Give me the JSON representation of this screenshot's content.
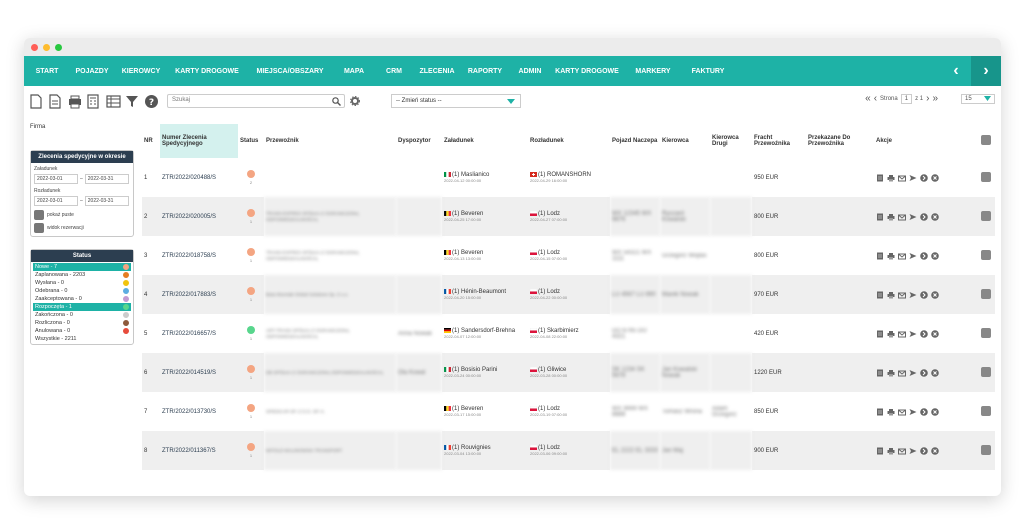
{
  "nav": {
    "items": [
      "START",
      "POJAZDY",
      "KIEROWCY",
      "KARTY DROGOWE",
      "MIEJSCA/OBSZARY",
      "MAPA",
      "CRM",
      "ZLECENIA",
      "RAPORTY",
      "ADMIN",
      "KARTY DROGOWE",
      "MARKERY",
      "FAKTURY"
    ],
    "prev": "‹",
    "next": "›"
  },
  "toolbar": {
    "search_placeholder": "Szukaj",
    "status_select": "-- Zmień status --",
    "pager": {
      "label": "Strona",
      "page": "1",
      "of": "z 1",
      "per_page": "15"
    }
  },
  "sidebar": {
    "firma_label": "Firma",
    "filter_title": "Zlecenia spedycyjne w okresie",
    "zaladunek_label": "Załadunek",
    "rozladunek_label": "Rozładunek",
    "date_from": "2022-03-01",
    "date_to": "2022-03-31",
    "dash": "–",
    "check_empty": "pokaż puste",
    "check_reserved": "widok rezerwacji",
    "status_title": "Status",
    "statuses": [
      {
        "label": "Nowe - 7",
        "color": "#f4a582",
        "active": true
      },
      {
        "label": "Zaplanowana - 2203",
        "color": "#e67e22",
        "active": false
      },
      {
        "label": "Wysłana - 0",
        "color": "#f1c40f",
        "active": false
      },
      {
        "label": "Odebrana - 0",
        "color": "#5dade2",
        "active": false
      },
      {
        "label": "Zaakceptowana - 0",
        "color": "#c39bd3",
        "active": false
      },
      {
        "label": "Rozpoczęta - 1",
        "color": "#58d68d",
        "active": true
      },
      {
        "label": "Zakończona - 0",
        "color": "#cccccc",
        "active": false
      },
      {
        "label": "Rozliczona - 0",
        "color": "#8e5a3c",
        "active": false
      },
      {
        "label": "Anulowana - 0",
        "color": "#e74c3c",
        "active": false
      },
      {
        "label": "Wszystkie - 2211",
        "color": "",
        "active": false
      }
    ]
  },
  "table": {
    "headers": {
      "nr": "NR",
      "numer": "Numer Zlecenia Spedycyjnego",
      "status": "Status",
      "przewoznik": "Przewoźnik",
      "dyspozytor": "Dyspozytor",
      "zaladunek": "Załadunek",
      "rozladunek": "Rozładunek",
      "pojazd": "Pojazd Naczepa",
      "kierowca": "Kierowca",
      "kierowca2": "Kierowca Drugi",
      "fracht": "Fracht Przewoźnika",
      "przekazane": "Przekazane Do Przewoźnika",
      "akcje": "Akcje"
    },
    "rows": [
      {
        "nr": "1",
        "numer": "ZTR/2022/020488/S",
        "status_color": "#f4a582",
        "status_num": "2",
        "przewoznik": "",
        "dyspozytor": "",
        "zal_flag": "it",
        "zal": "(1) Maslianico",
        "zal_date": "2022-04-12 00:00:00",
        "roz_flag": "ch",
        "roz": "(1) ROMANSHORN",
        "roz_date": "2022-04-29 16:00:00",
        "pojazd": "",
        "kierowca": "",
        "kierowca2": "",
        "fracht": "950 EUR"
      },
      {
        "nr": "2",
        "numer": "ZTR/2022/020005/S",
        "status_color": "#f4a582",
        "status_num": "1",
        "przewoznik": "TRANS-EXPRES SPÓŁKA Z OGRANICZONĄ ODPOWIEDZIALNOŚCIĄ",
        "dyspozytor": "",
        "zal_flag": "be",
        "zal": "(1) Beveren",
        "zal_date": "2022-04-25 17:00:00",
        "roz_flag": "pl",
        "roz": "(1) Lodz",
        "roz_date": "2022-04-27 07:00:00",
        "pojazd": "WX 12345 WX 9876",
        "kierowca": "Ryszard Kowalski",
        "kierowca2": "",
        "fracht": "800 EUR"
      },
      {
        "nr": "3",
        "numer": "ZTR/2022/018758/S",
        "status_color": "#f4a582",
        "status_num": "1",
        "przewoznik": "TRANS-EXPRES SPÓŁKA Z OGRANICZONĄ ODPOWIEDZIALNOŚCIĄ",
        "dyspozytor": "",
        "zal_flag": "be",
        "zal": "(1) Beveren",
        "zal_date": "2022-04-13 13:00:00",
        "roz_flag": "pl",
        "roz": "(1) Lodz",
        "roz_date": "2022-04-15 07:00:00",
        "pojazd": "WX 54321 WX 1111",
        "kierowca": "Grzegorz Wojtas",
        "kierowca2": "",
        "fracht": "800 EUR"
      },
      {
        "nr": "4",
        "numer": "ZTR/2022/017883/S",
        "status_color": "#f4a582",
        "status_num": "1",
        "przewoznik": "Beta Wozniak Global Solutions Sp. Z o.o.",
        "dyspozytor": "",
        "zal_flag": "fr",
        "zal": "(1) Hénin-Beaumont",
        "zal_date": "2022-04-20 15:00:00",
        "roz_flag": "pl",
        "roz": "(1) Lodz",
        "roz_date": "2022-04-22 00:00:00",
        "pojazd": "LU 4567 LU 890",
        "kierowca": "Marek Nowak",
        "kierowca2": "",
        "fracht": "970 EUR"
      },
      {
        "nr": "5",
        "numer": "ZTR/2022/016657/S",
        "status_color": "#58d68d",
        "status_num": "1",
        "przewoznik": "ART-TRANS SPÓŁKA Z OGRANICZONĄ ODPOWIEDZIALNOŚCIĄ",
        "dyspozytor": "Anna Nowak",
        "zal_flag": "de",
        "zal": "(1) Sandersdorf-Brehna",
        "zal_date": "2022-04-07 12:00:00",
        "roz_flag": "pl",
        "roz": "(1) Skarbimierz",
        "roz_date": "2022-04-08 22:00:00",
        "pojazd": "DO 8765 DO 4321",
        "kierowca": "",
        "kierowca2": "",
        "fracht": "420 EUR"
      },
      {
        "nr": "6",
        "numer": "ZTR/2022/014519/S",
        "status_color": "#f4a582",
        "status_num": "1",
        "przewoznik": "DB SPÓŁKA Z OGRANICZONĄ ODPOWIEDZIALNOŚCIĄ",
        "dyspozytor": "Ola Kowal",
        "zal_flag": "it",
        "zal": "(1) Bosisio Parini",
        "zal_date": "2022-03-24 00:00:00",
        "roz_flag": "pl",
        "roz": "(1) Gliwice",
        "roz_date": "2022-03-28 00:00:00",
        "pojazd": "SK 1234 SK 5678",
        "kierowca": "Jan Kowalski Nowak",
        "kierowca2": "",
        "fracht": "1220 EUR"
      },
      {
        "nr": "7",
        "numer": "ZTR/2022/013730/S",
        "status_color": "#f4a582",
        "status_num": "1",
        "przewoznik": "SPEDICAR SP. Z O.O. SP. K.",
        "dyspozytor": "",
        "zal_flag": "be",
        "zal": "(1) Beveren",
        "zal_date": "2022-03-17 15:00:00",
        "roz_flag": "pl",
        "roz": "(1) Lodz",
        "roz_date": "2022-03-19 07:00:00",
        "pojazd": "WX 9999 WX 8888",
        "kierowca": "Tomasz Wrona",
        "kierowca2": "Adam Grzegorz",
        "fracht": "850 EUR"
      },
      {
        "nr": "8",
        "numer": "ZTR/2022/011367/S",
        "status_color": "#f4a582",
        "status_num": "1",
        "przewoznik": "WITOLD MALINOWSKI TRANSPORT",
        "dyspozytor": "",
        "zal_flag": "fr",
        "zal": "(1) Rouvignies",
        "zal_date": "2022-03-04 13:00:00",
        "roz_flag": "pl",
        "roz": "(1) Lodz",
        "roz_date": "2022-03-06 09:00:00",
        "pojazd": "EL 2222 EL 3333",
        "kierowca": "Jan Maj",
        "kierowca2": "",
        "fracht": "900 EUR"
      }
    ]
  }
}
